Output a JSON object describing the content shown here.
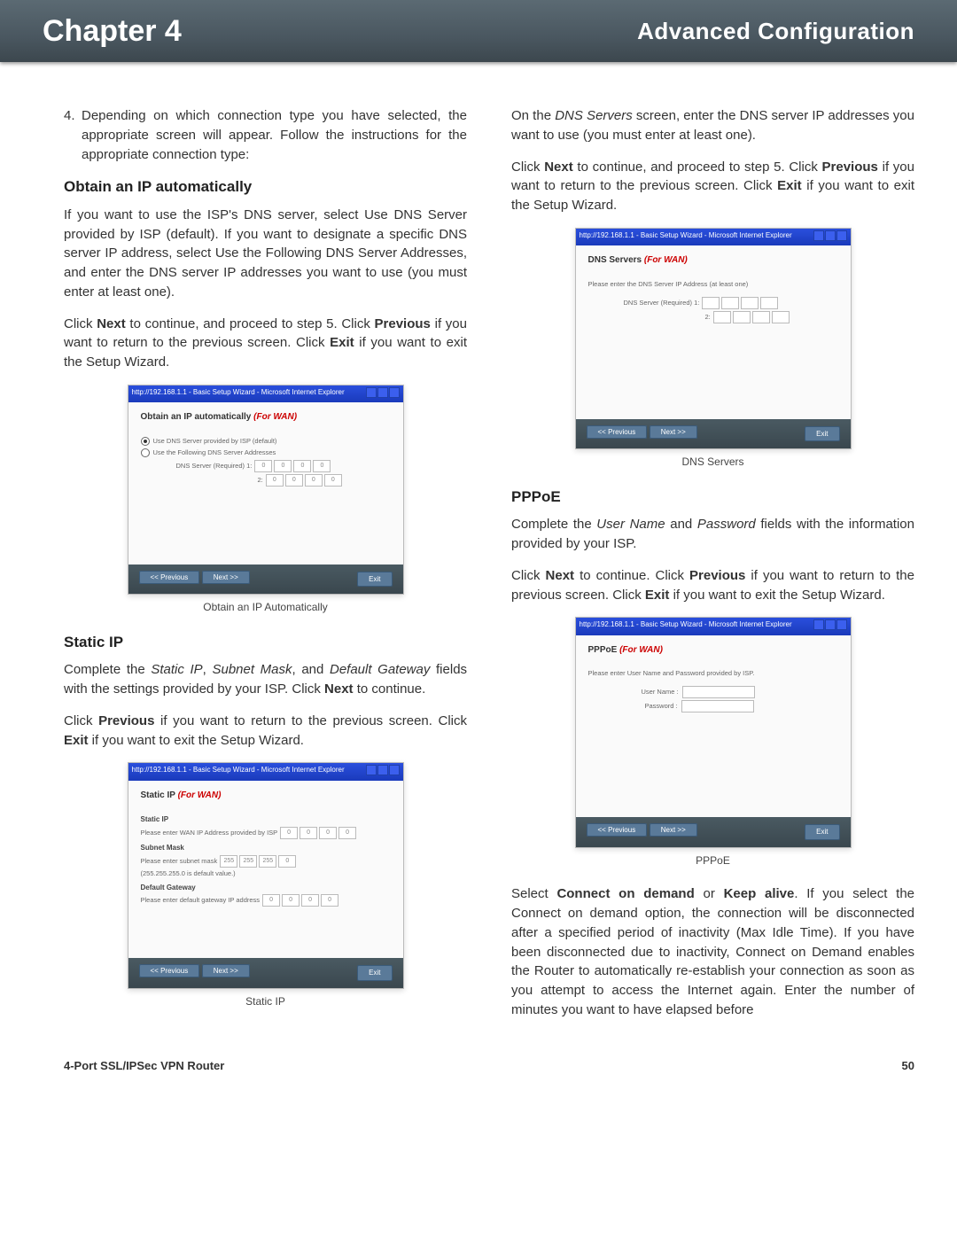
{
  "header": {
    "chapter": "Chapter 4",
    "section": "Advanced Configuration"
  },
  "left": {
    "p1_num": "4.",
    "p1": "Depending on which connection type you have selected, the appropriate screen will appear. Follow the instructions for the appropriate connection type:",
    "h1": "Obtain an IP automatically",
    "p2": "If you want to use the ISP's DNS server, select Use DNS Server provided by ISP (default). If you want to designate a specific DNS server IP address, select Use the Following DNS Server Addresses, and enter the DNS server IP addresses you want to use (you must enter at least one).",
    "p3a": "Click ",
    "p3b": "Next",
    "p3c": " to continue, and proceed to step 5. Click ",
    "p3d": "Previous",
    "p3e": " if you want to return to the previous screen. Click ",
    "p3f": "Exit",
    "p3g": " if you want to exit the Setup Wizard.",
    "cap1": "Obtain an IP Automatically",
    "h2": "Static IP",
    "p4a": "Complete the ",
    "p4b": "Static IP",
    "p4c": ", ",
    "p4d": "Subnet Mask",
    "p4e": ", and ",
    "p4f": "Default Gateway",
    "p4g": " fields with the settings provided by your ISP. Click ",
    "p4h": "Next",
    "p4i": " to continue.",
    "p5a": "Click ",
    "p5b": "Previous",
    "p5c": " if you want to return to the previous screen. Click ",
    "p5d": "Exit",
    "p5e": " if you want to exit the Setup Wizard.",
    "cap2": "Static IP"
  },
  "right": {
    "p1a": "On the ",
    "p1b": "DNS Servers",
    "p1c": " screen, enter the DNS server IP addresses you want to use (you must enter at least one).",
    "p2a": "Click ",
    "p2b": "Next",
    "p2c": " to continue, and proceed to step 5. Click ",
    "p2d": "Previous",
    "p2e": " if you want to return to the previous screen. Click ",
    "p2f": "Exit",
    "p2g": " if you want to exit the Setup Wizard.",
    "cap1": "DNS Servers",
    "h1": "PPPoE",
    "p3a": "Complete the ",
    "p3b": "User Name",
    "p3c": " and ",
    "p3d": "Password",
    "p3e": " fields with the information provided by your ISP.",
    "p4a": "Click ",
    "p4b": "Next",
    "p4c": " to continue. Click ",
    "p4d": "Previous",
    "p4e": " if you want to return to the previous screen. Click ",
    "p4f": "Exit",
    "p4g": " if you want to exit the Setup Wizard.",
    "cap2": "PPPoE",
    "p5a": "Select ",
    "p5b": "Connect on demand",
    "p5c": " or ",
    "p5d": "Keep alive",
    "p5e": ". If you select the Connect on demand option, the connection will be disconnected after a specified period of inactivity (Max Idle Time). If you have been disconnected due to inactivity, Connect on Demand enables the Router to automatically re-establish your connection as soon as you attempt to access the Internet again. Enter the number of minutes you want to have elapsed before"
  },
  "shot": {
    "wintitle": "http://192.168.1.1 - Basic Setup Wizard - Microsoft Internet Explorer",
    "forwan": "(For WAN)",
    "prev": "<< Previous",
    "next": "Next >>",
    "exit": "Exit",
    "s1": {
      "title": "Obtain an IP automatically ",
      "r1": "Use DNS Server provided by ISP (default)",
      "r2": "Use the Following DNS Server Addresses",
      "lbl1": "DNS Server (Required) 1:",
      "lbl2": "2:",
      "z": "0"
    },
    "s2": {
      "title": "Static IP ",
      "h1": "Static IP",
      "t1": "Please enter WAN IP Address provided by ISP",
      "v1": "0",
      "h2": "Subnet Mask",
      "t2": "Please enter subnet mask",
      "v2a": "255",
      "v2b": "0",
      "t2n": "(255.255.255.0 is default value.)",
      "h3": "Default Gateway",
      "t3": "Please enter default gateway IP address",
      "v3": "0"
    },
    "s3": {
      "title": "DNS Servers ",
      "t1": "Please enter the DNS Server IP Address (at least one)",
      "lbl1": "DNS Server (Required) 1:",
      "lbl2": "2:"
    },
    "s4": {
      "title": "PPPoE ",
      "t1": "Please enter User Name and Password provided by ISP.",
      "lbl1": "User Name :",
      "lbl2": "Password :"
    }
  },
  "footer": {
    "product": "4-Port SSL/IPSec VPN Router",
    "page": "50"
  }
}
